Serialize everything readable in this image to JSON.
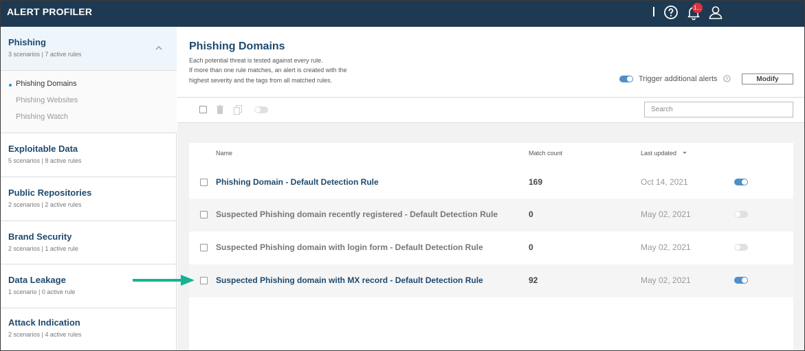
{
  "app": {
    "title": "ALERT PROFILER",
    "notification_badge": "1..."
  },
  "sidebar": {
    "groups": [
      {
        "title": "Phishing",
        "subtitle": "3 scenarios | 7 active rules",
        "expanded": true,
        "items": [
          {
            "label": "Phishing Domains",
            "active": true
          },
          {
            "label": "Phishing Websites",
            "active": false
          },
          {
            "label": "Phishing Watch",
            "active": false
          }
        ]
      },
      {
        "title": "Exploitable Data",
        "subtitle": "5 scenarios | 8 active rules"
      },
      {
        "title": "Public Repositories",
        "subtitle": "2 scenarios | 2 active rules"
      },
      {
        "title": "Brand Security",
        "subtitle": "2 scenarios | 1 active rule"
      },
      {
        "title": "Data Leakage",
        "subtitle": "1 scenario | 0 active rule"
      },
      {
        "title": "Attack Indication",
        "subtitle": "2 scenarios | 4 active rules"
      }
    ]
  },
  "main": {
    "title": "Phishing Domains",
    "description": [
      "Each potential threat is tested against every rule.",
      "If more than one rule matches, an alert is created with the",
      "highest severity and the tags from all matched rules."
    ],
    "trigger_label": "Trigger additional alerts",
    "trigger_enabled": true,
    "modify_label": "Modify",
    "search_placeholder": "Search",
    "columns": {
      "name": "Name",
      "match_count": "Match count",
      "last_updated": "Last updated"
    },
    "rules": [
      {
        "name": "Phishing Domain - Default Detection Rule",
        "count": "169",
        "date": "Oct 14, 2021",
        "enabled": true
      },
      {
        "name": "Suspected Phishing domain recently registered - Default Detection Rule",
        "count": "0",
        "date": "May 02, 2021",
        "enabled": false
      },
      {
        "name": "Suspected Phishing domain with login form - Default Detection Rule",
        "count": "0",
        "date": "May 02, 2021",
        "enabled": false
      },
      {
        "name": "Suspected Phishing domain with MX record - Default Detection Rule",
        "count": "92",
        "date": "May 02, 2021",
        "enabled": true
      }
    ]
  },
  "colors": {
    "topbar": "#1e3a52",
    "accent": "#4e8fc7",
    "title_text": "#1e4a6e",
    "annotation_arrow": "#14b391",
    "badge": "#d9333f"
  }
}
